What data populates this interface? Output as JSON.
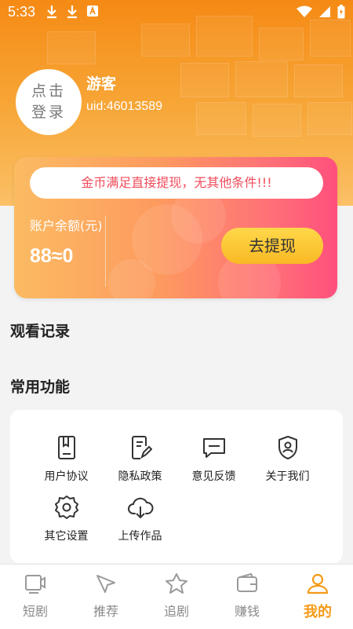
{
  "status_bar": {
    "time": "5:33",
    "left_icons": [
      "download-icon",
      "download-icon",
      "notification-a-icon"
    ],
    "right_icons": [
      "wifi-icon",
      "signal-icon",
      "battery-icon"
    ]
  },
  "profile": {
    "avatar_text": "点击登录",
    "name": "游客",
    "uid": "uid:46013589"
  },
  "wallet": {
    "notice": "金币满足直接提现，无其他条件!!!",
    "balance_label": "账户余额(元)",
    "balance_value": "88≈0",
    "withdraw_label": "去提现"
  },
  "sections": {
    "history_title": "观看记录",
    "functions_title": "常用功能"
  },
  "functions": [
    {
      "label": "用户协议",
      "icon": "document-icon"
    },
    {
      "label": "隐私政策",
      "icon": "edit-document-icon"
    },
    {
      "label": "意见反馈",
      "icon": "message-icon"
    },
    {
      "label": "关于我们",
      "icon": "shield-user-icon"
    },
    {
      "label": "其它设置",
      "icon": "settings-icon"
    },
    {
      "label": "上传作品",
      "icon": "cloud-upload-icon"
    }
  ],
  "tabs": [
    {
      "label": "短剧",
      "icon": "video-icon",
      "active": false
    },
    {
      "label": "推荐",
      "icon": "cursor-icon",
      "active": false
    },
    {
      "label": "追剧",
      "icon": "star-icon",
      "active": false
    },
    {
      "label": "赚钱",
      "icon": "wallet-icon",
      "active": false
    },
    {
      "label": "我的",
      "icon": "user-icon",
      "active": true
    }
  ],
  "colors": {
    "accent": "#f59a16",
    "notice_text": "#f04b5a",
    "button_yellow": "#ffd84a"
  }
}
